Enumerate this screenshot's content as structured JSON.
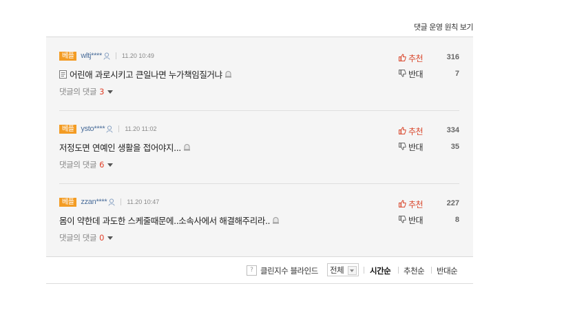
{
  "header": {
    "policy_link": "댓글 운영 원칙 보기"
  },
  "comments": [
    {
      "badge": "베플",
      "user": "wltj****",
      "time": "11.20 10:49",
      "text": "어린애 과로시키고 큰일나면 누가책임질거냐",
      "has_doc_icon": true,
      "reply_label": "댓글의 댓글",
      "reply_count": "3",
      "up_label": "추천",
      "up_count": "316",
      "down_label": "반대",
      "down_count": "7"
    },
    {
      "badge": "베플",
      "user": "ysto****",
      "time": "11.20 11:02",
      "text": "저정도면 연예인 생활을 접어야지...",
      "has_doc_icon": false,
      "reply_label": "댓글의 댓글",
      "reply_count": "6",
      "up_label": "추천",
      "up_count": "334",
      "down_label": "반대",
      "down_count": "35"
    },
    {
      "badge": "베플",
      "user": "zzan****",
      "time": "11.20 10:47",
      "text": "몸이 약한데 과도한 스케줄때문에..소속사에서 해결해주리라..",
      "has_doc_icon": false,
      "reply_label": "댓글의 댓글",
      "reply_count": "0",
      "up_label": "추천",
      "up_count": "227",
      "down_label": "반대",
      "down_count": "8"
    }
  ],
  "footer": {
    "help_symbol": "?",
    "clean_blind_label": "클린지수 블라인드",
    "filter_value": "전체",
    "sort_time": "시간순",
    "sort_recommend": "추천순",
    "sort_oppose": "반대순"
  },
  "colors": {
    "badge": "#f39c24",
    "up": "#d9462b",
    "user": "#4a6d9a",
    "reply_count": "#e0402a"
  }
}
